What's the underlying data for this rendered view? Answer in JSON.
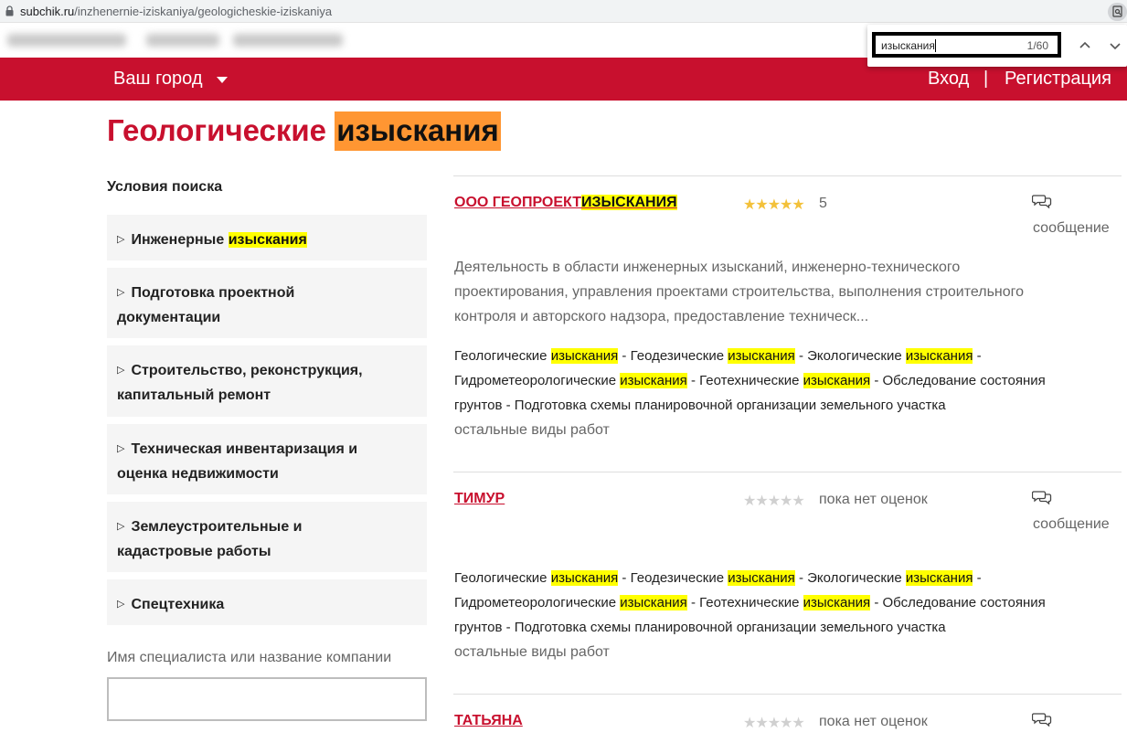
{
  "browser": {
    "url_domain": "subchik.ru",
    "url_path": "/inzhenernie-iziskaniya/geologicheskie-iziskaniya",
    "find_query": "изыскания",
    "find_count": "1/60"
  },
  "header": {
    "city": "Ваш город",
    "login": "Вход",
    "separator": "|",
    "register": "Регистрация"
  },
  "page": {
    "title_part1": "Геологические",
    "title_highlight": "изыскания"
  },
  "sidebar": {
    "heading": "Условия поиска",
    "categories": [
      {
        "before": "Инженерные",
        "highlight": "изыскания",
        "line2": ""
      },
      {
        "before": "Подготовка проектной",
        "highlight": "",
        "line2": "документации"
      },
      {
        "before": "Строительство, реконструкция,",
        "highlight": "",
        "line2": "капитальный ремонт"
      },
      {
        "before": "Техническая инвентаризация и",
        "highlight": "",
        "line2": "оценка недвижимости"
      },
      {
        "before": "Землеустроительные и",
        "highlight": "",
        "line2": "кадастровые работы"
      },
      {
        "before": "Спецтехника",
        "highlight": "",
        "line2": ""
      }
    ],
    "name_label": "Имя специалиста или название компании",
    "name_value": ""
  },
  "results": [
    {
      "name_part1": "ООО ГЕОПРОЕКТ",
      "name_highlight": "ИЗЫСКАНИЯ",
      "stars": "★★★★★",
      "rating": "5",
      "message": "сообщение",
      "description_lines": [
        "Деятельность в области инженерных изысканий, инженерно-технического",
        "проектирования, управления проектами строительства, выполнения строительного",
        "контроля и авторского надзора, предоставление техническ..."
      ],
      "more": "остальные виды работ"
    },
    {
      "name_part1": "ТИМУР",
      "name_highlight": "",
      "stars": "★★★★★",
      "rating": "пока нет оценок",
      "message": "сообщение",
      "more": "остальные виды работ"
    },
    {
      "name_part1": "ТАТЬЯНА",
      "name_highlight": "",
      "stars": "★★★★★",
      "rating": "пока нет оценок",
      "message": ""
    }
  ],
  "works": {
    "w1": "Геологические",
    "w2": "Геодезические",
    "w3": "Экологические",
    "w4": "Гидрометеорологические",
    "w5": "Геотехнические",
    "w6": "Обследование состояния",
    "w7": "грунтов",
    "w8": "Подготовка схемы планировочной организации земельного участка",
    "hl": "изыскания",
    "dash": " - "
  },
  "colors": {
    "brand_red": "#c8102e",
    "highlight_yellow": "#ffff00",
    "highlight_orange": "#ff9632",
    "star_gold": "#f3c13a",
    "star_grey": "#d0d0d0"
  }
}
